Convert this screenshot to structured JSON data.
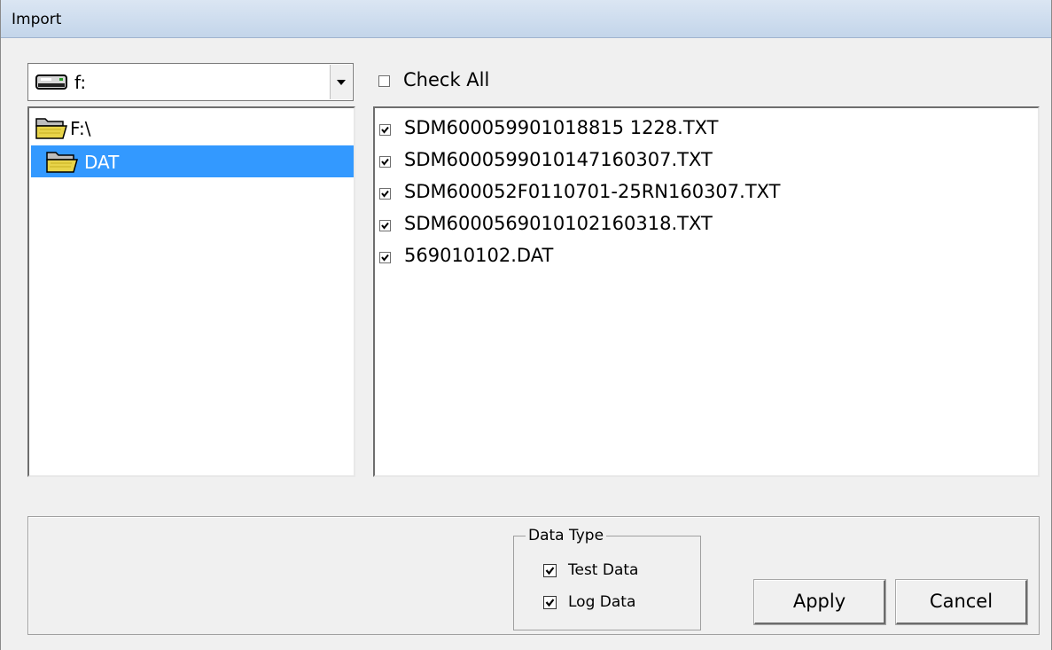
{
  "window": {
    "title": "Import"
  },
  "drive": {
    "label": "f:",
    "icon": "drive-icon"
  },
  "tree": {
    "items": [
      {
        "label": "F:\\",
        "icon": "open-folder-icon",
        "selected": false
      },
      {
        "label": "DAT",
        "icon": "open-folder-icon",
        "selected": true
      }
    ]
  },
  "check_all": {
    "label": "Check All",
    "checked": false
  },
  "files": [
    {
      "name": "SDM600059901018815 1228.TXT",
      "checked": true
    },
    {
      "name": "SDM6000599010147160307.TXT",
      "checked": true
    },
    {
      "name": "SDM600052F0110701-25RN160307.TXT",
      "checked": true
    },
    {
      "name": "SDM6000569010102160318.TXT",
      "checked": true
    },
    {
      "name": "569010102.DAT",
      "checked": true
    }
  ],
  "data_type": {
    "title": "Data Type",
    "options": [
      {
        "label": "Test Data",
        "checked": true
      },
      {
        "label": "Log Data",
        "checked": true
      }
    ]
  },
  "buttons": {
    "apply": "Apply",
    "cancel": "Cancel"
  },
  "colors": {
    "selection": "#3399ff",
    "titlebar": "#c9d9ec",
    "folder": "#e8d44a"
  }
}
